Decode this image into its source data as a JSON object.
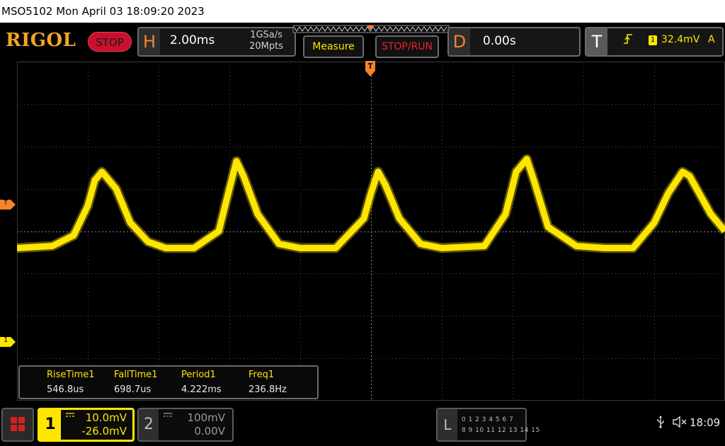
{
  "title_bar": {
    "text": "MSO5102  Mon April 03 18:09:20 2023"
  },
  "header": {
    "logo": "RIGOL",
    "status": "STOP",
    "horizontal": {
      "letter": "H",
      "timebase": "2.00ms",
      "sample_rate": "1GSa/s",
      "memory_depth": "20Mpts"
    },
    "measure_button": "Measure",
    "stop_run_button": "STOP/RUN",
    "delay": {
      "letter": "D",
      "value": "0.00s"
    },
    "trigger": {
      "letter": "T",
      "edge_icon": "rising-edge-icon",
      "source": "1",
      "level": "32.4mV",
      "mode": "A"
    }
  },
  "markers": {
    "trigger_level_label": "T",
    "channel1_label": "1"
  },
  "measurements": [
    {
      "name": "RiseTime1",
      "value": "546.8us"
    },
    {
      "name": "FallTime1",
      "value": "698.7us"
    },
    {
      "name": "Period1",
      "value": "4.222ms"
    },
    {
      "name": "Freq1",
      "value": "236.8Hz"
    }
  ],
  "channels": [
    {
      "number": "1",
      "scale": "10.0mV",
      "offset": "-26.0mV",
      "color": "#ffe600",
      "active": true
    },
    {
      "number": "2",
      "scale": "100mV",
      "offset": "0.00V",
      "color": "#9a9a9a",
      "active": false
    }
  ],
  "logic": {
    "letter": "L",
    "row1": "0 1 2 3  4 5 6 7",
    "row2": "8 9 10 11  12 13 14 15"
  },
  "status_bar": {
    "usb_icon": "usb-icon",
    "speaker_icon": "speaker-muted-icon",
    "time": "18:09"
  },
  "colors": {
    "trace": "#ffe600",
    "accent_orange": "#f5832a",
    "stop_red": "#c8102e"
  },
  "chart_data": {
    "type": "line",
    "series": [
      {
        "x_ms": [
          -10,
          -9,
          -8.4,
          -8.0,
          -7.8,
          -7.6,
          -7.2,
          -6.8,
          -6.3,
          -5.8,
          -5.0,
          -4.3,
          -4.0,
          -3.8,
          -3.6,
          -3.2,
          -2.6,
          -2.0,
          -1.0,
          -0.2,
          0.0,
          0.2,
          0.4,
          0.8,
          1.4,
          2.0,
          3.2,
          3.8,
          4.1,
          4.4,
          4.6,
          5.0,
          5.8,
          6.6,
          7.4,
          8.0,
          8.4,
          8.8,
          9.0,
          9.6,
          10
        ],
        "values_mV": [
          -20,
          -19.5,
          -17,
          -10,
          -4,
          -2,
          -6,
          -14,
          -18.5,
          -20,
          -20,
          -16,
          -6,
          0.5,
          -3,
          -12,
          -19,
          -20,
          -20,
          -13,
          -7,
          -2,
          -5,
          -13,
          -19,
          -20,
          -19.5,
          -12,
          -2,
          1,
          -4,
          -15,
          -19.5,
          -20,
          -20,
          -14,
          -7,
          -2,
          -3,
          -12,
          -16
        ]
      }
    ],
    "xlim_ms": [
      -10,
      10
    ],
    "ylim_mV": [
      -56,
      24
    ],
    "grid": true,
    "divisions": {
      "horizontal": 10,
      "vertical": 8
    }
  }
}
